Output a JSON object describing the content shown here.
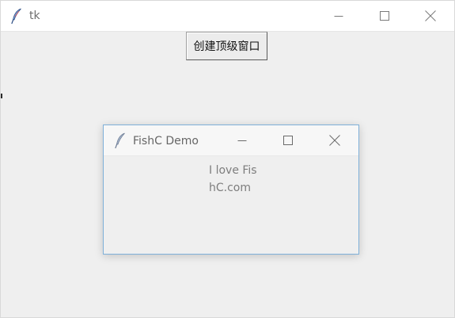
{
  "main_window": {
    "title": "tk",
    "create_button_label": "创建顶级窗口"
  },
  "toplevel_window": {
    "title": "FishC Demo",
    "label_text": "I love FishC.com"
  },
  "icons": {
    "app": "feather-icon",
    "minimize": "minimize-icon",
    "maximize": "maximize-icon",
    "close": "close-icon"
  }
}
